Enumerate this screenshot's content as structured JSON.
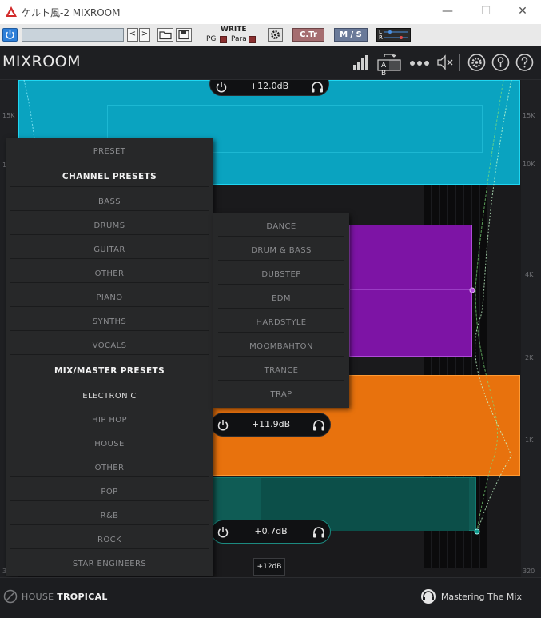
{
  "window": {
    "title": "ケルト風-2 MIXROOM",
    "minimize": "—",
    "maximize": "☐",
    "close": "✕"
  },
  "hostbar": {
    "prev": "<",
    "next": ">",
    "write": "WRITE",
    "pg": "PG",
    "para": "Para",
    "ctr": "C.Tr",
    "ms": "M / S",
    "l": "L",
    "r": "R"
  },
  "header": {
    "brand": "MIXROOM",
    "ab": "A B"
  },
  "y_axis": {
    "left": [
      "15K",
      "1",
      "320"
    ],
    "right": [
      "15K",
      "10K",
      "4K",
      "2K",
      "1K",
      "320"
    ]
  },
  "bands": {
    "top_gain": "+12.0dB",
    "mid_gain": "+11.9dB",
    "low_gain": "+0.7dB",
    "tag": "+12dB"
  },
  "menu": {
    "items": [
      {
        "label": "PRESET",
        "kind": "normal"
      },
      {
        "label": "CHANNEL PRESETS",
        "kind": "head"
      },
      {
        "label": "BASS",
        "kind": "normal"
      },
      {
        "label": "DRUMS",
        "kind": "normal"
      },
      {
        "label": "GUITAR",
        "kind": "normal"
      },
      {
        "label": "OTHER",
        "kind": "normal"
      },
      {
        "label": "PIANO",
        "kind": "normal"
      },
      {
        "label": "SYNTHS",
        "kind": "normal"
      },
      {
        "label": "VOCALS",
        "kind": "normal"
      },
      {
        "label": "MIX/MASTER PRESETS",
        "kind": "head"
      },
      {
        "label": "ELECTRONIC",
        "kind": "white"
      },
      {
        "label": "HIP HOP",
        "kind": "normal"
      },
      {
        "label": "HOUSE",
        "kind": "normal"
      },
      {
        "label": "OTHER",
        "kind": "normal"
      },
      {
        "label": "POP",
        "kind": "normal"
      },
      {
        "label": "R&B",
        "kind": "normal"
      },
      {
        "label": "ROCK",
        "kind": "normal"
      },
      {
        "label": "STAR ENGINEERS",
        "kind": "normal"
      }
    ]
  },
  "submenu": {
    "items": [
      "DANCE",
      "DRUM & BASS",
      "DUBSTEP",
      "EDM",
      "HARDSTYLE",
      "MOOMBAHTON",
      "TRANCE",
      "TRAP"
    ]
  },
  "footer": {
    "preset_category": "HOUSE",
    "preset_name": "TROPICAL",
    "company": "Mastering The Mix"
  },
  "colors": {
    "band_cyan": "#0aa3c0",
    "band_purple": "#7d14a5",
    "band_orange": "#e8720d",
    "band_teal": "#0f5c55",
    "ctr_button": "#a56d70",
    "ms_button": "#6a7a99"
  }
}
